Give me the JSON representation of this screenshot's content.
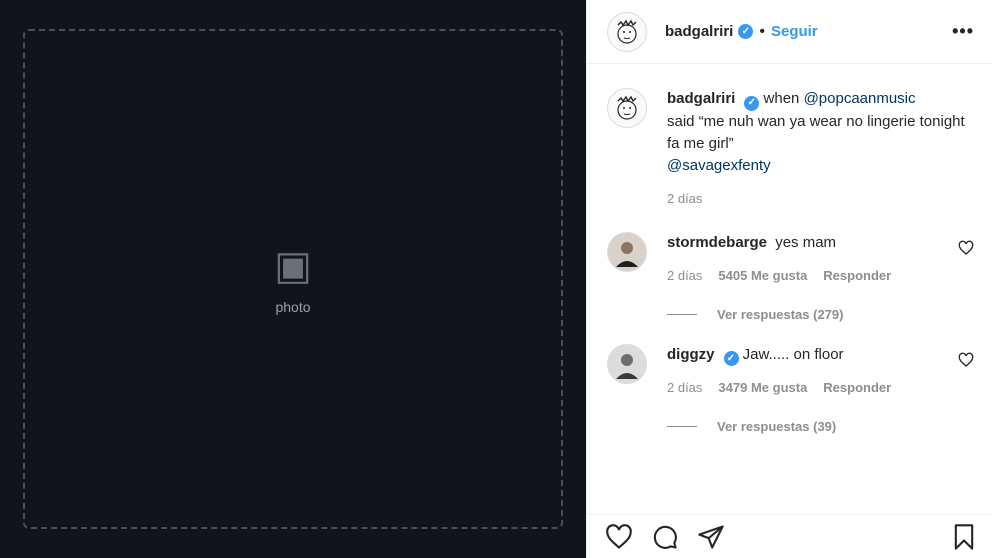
{
  "media": {
    "placeholder_label": "photo"
  },
  "header": {
    "username": "badgalriri",
    "follow_label": "Seguir",
    "more_label": "•••"
  },
  "caption": {
    "username": "badgalriri",
    "text_before": "when",
    "mention_1": "@popcaanmusic",
    "text_after": "said “me nuh wan ya wear no lingerie tonight fa me girl”",
    "mention_2": "@savagexfenty",
    "time": "2 días"
  },
  "comments": [
    {
      "username": "stormdebarge",
      "verified": false,
      "text": "yes mam",
      "time": "2 días",
      "likes": "5405 Me gusta",
      "reply_label": "Responder",
      "view_replies": "Ver respuestas (279)"
    },
    {
      "username": "diggzy",
      "verified": true,
      "text": "Jaw..... on floor",
      "time": "2 días",
      "likes": "3479 Me gusta",
      "reply_label": "Responder",
      "view_replies": "Ver respuestas (39)"
    }
  ],
  "icons": {
    "like": "heart-icon",
    "comment": "comment-icon",
    "share": "share-icon",
    "save": "bookmark-icon",
    "verified": "verified-badge-icon"
  },
  "colors": {
    "link": "#3897f0",
    "mention": "#003569",
    "muted": "#8e8e8e"
  }
}
